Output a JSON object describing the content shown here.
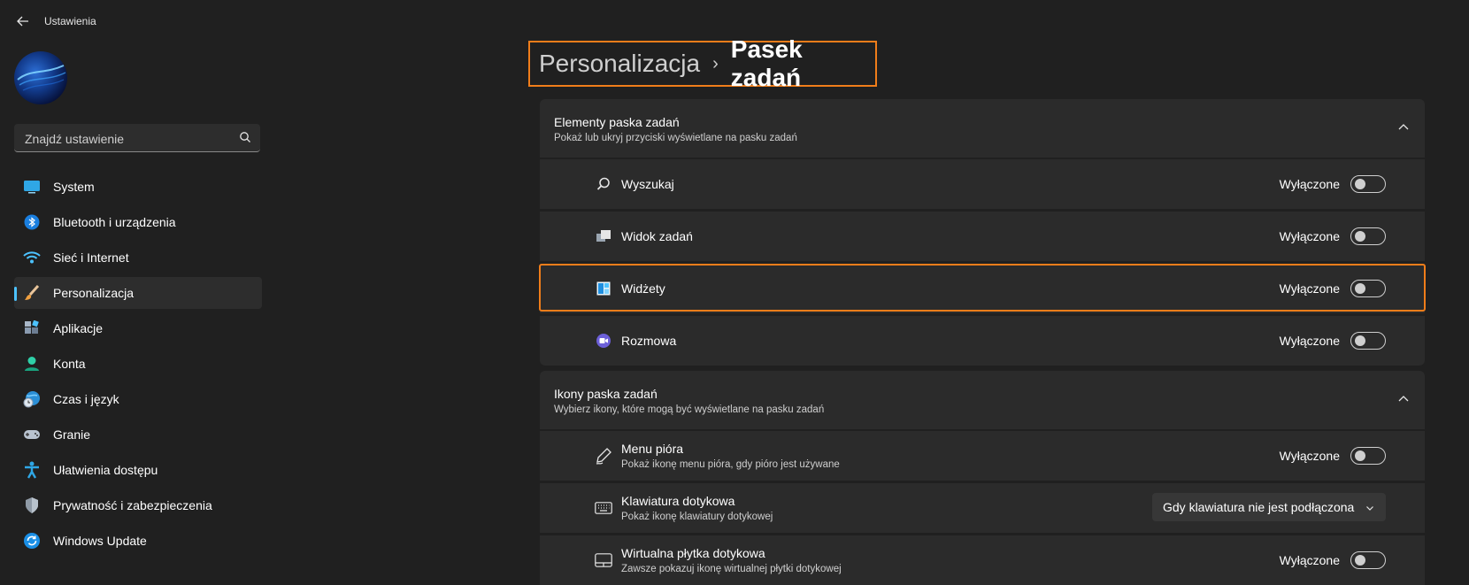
{
  "app": {
    "title": "Ustawienia"
  },
  "search": {
    "placeholder": "Znajdź ustawienie"
  },
  "sidebar": {
    "items": [
      {
        "label": "System",
        "icon": "monitor-icon"
      },
      {
        "label": "Bluetooth i urządzenia",
        "icon": "bluetooth-icon"
      },
      {
        "label": "Sieć i Internet",
        "icon": "wifi-icon"
      },
      {
        "label": "Personalizacja",
        "icon": "brush-icon",
        "active": true
      },
      {
        "label": "Aplikacje",
        "icon": "apps-icon"
      },
      {
        "label": "Konta",
        "icon": "person-icon"
      },
      {
        "label": "Czas i język",
        "icon": "globe-clock-icon"
      },
      {
        "label": "Granie",
        "icon": "gamepad-icon"
      },
      {
        "label": "Ułatwienia dostępu",
        "icon": "accessibility-icon"
      },
      {
        "label": "Prywatność i zabezpieczenia",
        "icon": "shield-icon"
      },
      {
        "label": "Windows Update",
        "icon": "update-icon"
      }
    ]
  },
  "breadcrumb": {
    "parent": "Personalizacja",
    "separator": "›",
    "current": "Pasek zadań"
  },
  "taskbar_items": {
    "title": "Elementy paska zadań",
    "subtitle": "Pokaż lub ukryj przyciski wyświetlane na pasku zadań",
    "rows": [
      {
        "label": "Wyszukaj",
        "state": "Wyłączone",
        "icon": "search-icon"
      },
      {
        "label": "Widok zadań",
        "state": "Wyłączone",
        "icon": "task-view-icon"
      },
      {
        "label": "Widżety",
        "state": "Wyłączone",
        "icon": "widgets-icon"
      },
      {
        "label": "Rozmowa",
        "state": "Wyłączone",
        "icon": "chat-icon"
      }
    ]
  },
  "taskbar_icons": {
    "title": "Ikony paska zadań",
    "subtitle": "Wybierz ikony, które mogą być wyświetlane na pasku zadań",
    "rows": [
      {
        "label": "Menu pióra",
        "sub": "Pokaż ikonę menu pióra, gdy pióro jest używane",
        "state": "Wyłączone",
        "icon": "pen-icon"
      },
      {
        "label": "Klawiatura dotykowa",
        "sub": "Pokaż ikonę klawiatury dotykowej",
        "dropdown": "Gdy klawiatura nie jest podłączona",
        "icon": "keyboard-icon"
      },
      {
        "label": "Wirtualna płytka dotykowa",
        "sub": "Zawsze pokazuj ikonę wirtualnej płytki dotykowej",
        "state": "Wyłączone",
        "icon": "touchpad-icon"
      }
    ]
  },
  "colors": {
    "accent": "#4cc2ff",
    "highlight": "#f07d1a",
    "background": "#202020",
    "card": "#2b2b2b"
  }
}
